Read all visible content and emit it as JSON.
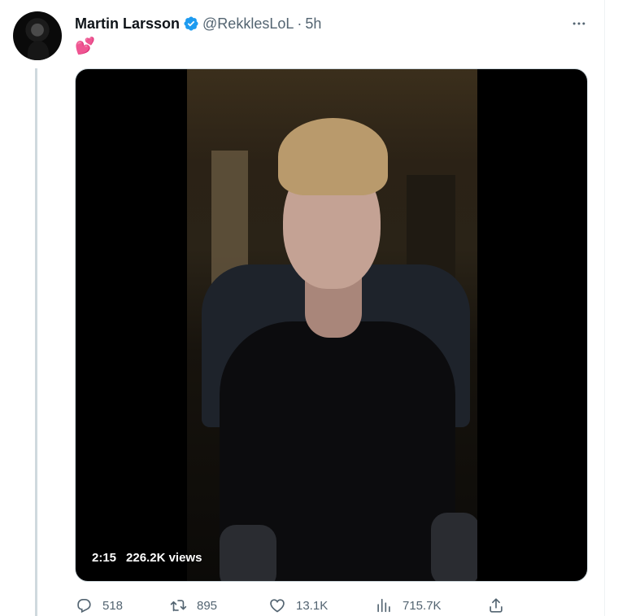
{
  "author": {
    "name": "Martin Larsson",
    "handle": "@RekklesLoL",
    "separator": "·",
    "time": "5h",
    "verified_color": "#1d9bf0"
  },
  "tweet": {
    "text": "💕"
  },
  "media": {
    "duration": "2:15",
    "views_label": "226.2K views"
  },
  "actions": {
    "replies": "518",
    "retweets": "895",
    "likes": "13.1K",
    "views": "715.7K"
  },
  "colors": {
    "secondary_text": "#536471",
    "thread_line": "#cfd9de"
  }
}
